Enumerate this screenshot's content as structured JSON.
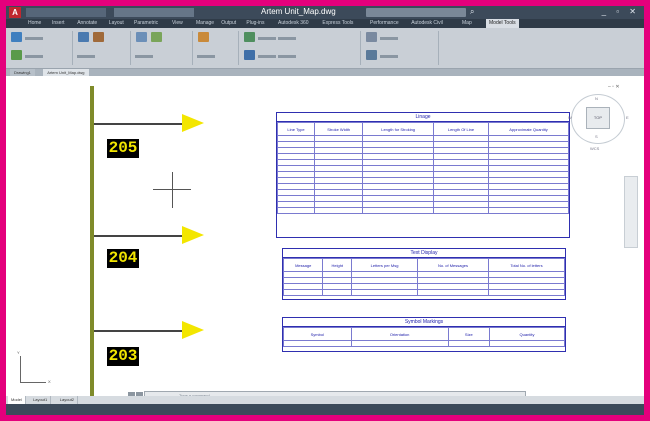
{
  "titlebar": {
    "logo": "A",
    "document_title": "Artem Unit_Map.dwg",
    "window_buttons": "_ ▫ ✕"
  },
  "ribbon_tabs": [
    "Home",
    "Insert",
    "Annotate",
    "Layout",
    "Parametric",
    "View",
    "Manage",
    "Output",
    "Plug-ins",
    "Autodesk 360",
    "Express Tools",
    "Performance",
    "Autodesk Civil",
    "Map",
    "Model Tools"
  ],
  "ribbon_active_tab": "Model Tools",
  "file_tabs": [
    "Drawing1",
    "Artem Unit_Map.dwg"
  ],
  "active_file_tab": "Artem Unit_Map.dwg",
  "drawing": {
    "markers": [
      "205",
      "204",
      "203"
    ],
    "colors": {
      "post": "#7f8b2a",
      "flag": "#f3e600",
      "label_bg": "#000000",
      "label_text": "#f3e600",
      "table_line": "#2f2fb0"
    }
  },
  "lineage_table": {
    "title": "Linage",
    "headers": [
      "Line Type",
      "Stroke Width",
      "Length for Stroking",
      "Length Of Line",
      "Approximate Quantity"
    ],
    "rows": [
      [
        "",
        "",
        "",
        "",
        ""
      ],
      [
        "",
        "",
        "",
        "",
        ""
      ],
      [
        "",
        "",
        "",
        "",
        ""
      ],
      [
        "",
        "",
        "",
        "",
        ""
      ],
      [
        "",
        "",
        "",
        "",
        ""
      ],
      [
        "",
        "",
        "",
        "",
        ""
      ],
      [
        "",
        "",
        "",
        "",
        ""
      ],
      [
        "",
        "",
        "",
        "",
        ""
      ],
      [
        "",
        "",
        "",
        "",
        ""
      ],
      [
        "",
        "",
        "",
        "",
        ""
      ],
      [
        "",
        "",
        "",
        "",
        ""
      ],
      [
        "",
        "",
        "",
        "",
        ""
      ],
      [
        "",
        "",
        "",
        "",
        ""
      ]
    ]
  },
  "text_table": {
    "title": "Text Display",
    "headers": [
      "Message",
      "Height",
      "Letters per Msg",
      "No. of Messages",
      "Total No. of letters"
    ],
    "rows": [
      [
        "",
        "",
        "",
        "",
        ""
      ],
      [
        "",
        "",
        "",
        "",
        ""
      ],
      [
        "",
        "",
        "",
        "",
        ""
      ],
      [
        "",
        "",
        "",
        "",
        ""
      ]
    ]
  },
  "symbol_table": {
    "title": "Symbol Markings",
    "headers": [
      "Symbol",
      "Orientation",
      "Size",
      "Quantity"
    ],
    "rows": [
      [
        "",
        "",
        "",
        ""
      ]
    ]
  },
  "viewcube": {
    "face": "TOP",
    "n": "N",
    "s": "S",
    "e": "E",
    "w": "W",
    "wcs": "WCS"
  },
  "ucs": {
    "x": "X",
    "y": "Y"
  },
  "command_line": {
    "placeholder": "Type a command"
  },
  "layout_tabs": [
    "Model",
    "Layout1",
    "Layout2"
  ],
  "active_layout_tab": "Model",
  "status": {
    "coords": "",
    "right": ""
  }
}
